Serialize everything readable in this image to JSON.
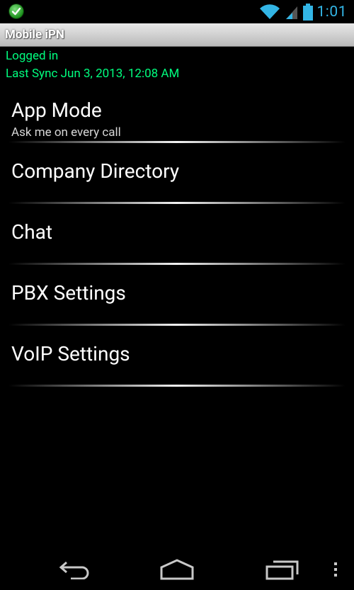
{
  "status_bar": {
    "time": "1:01",
    "icons": [
      "check-notification-icon",
      "wifi-icon",
      "signal-icon",
      "battery-icon"
    ],
    "accent_color": "#33b5e5"
  },
  "app": {
    "title": "Mobile iPN"
  },
  "status": {
    "login": "Logged in",
    "last_sync": "Last Sync Jun 3, 2013, 12:08 AM",
    "color": "#00ff7f"
  },
  "menu": {
    "items": [
      {
        "label": "App Mode",
        "sublabel": "Ask me on every call"
      },
      {
        "label": "Company Directory"
      },
      {
        "label": "Chat"
      },
      {
        "label": "PBX Settings"
      },
      {
        "label": "VoIP Settings"
      }
    ]
  },
  "nav_bar": {
    "buttons": [
      "back-icon",
      "home-icon",
      "recent-apps-icon",
      "overflow-menu-icon"
    ]
  }
}
